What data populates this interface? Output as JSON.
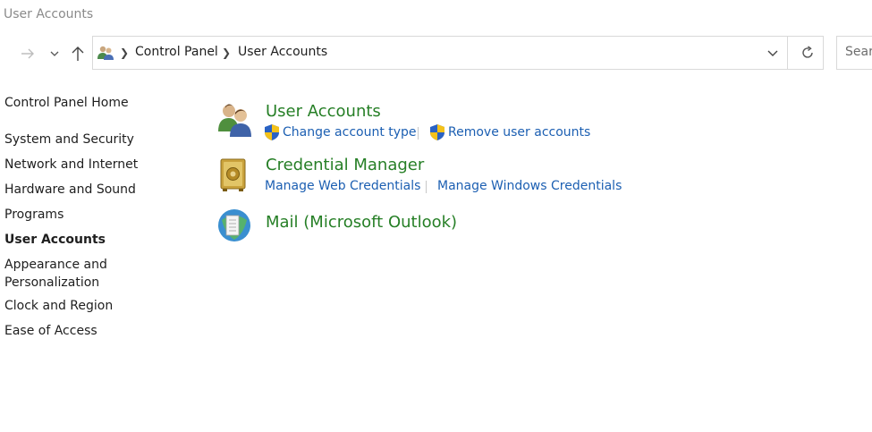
{
  "window": {
    "title": "User Accounts"
  },
  "navigation": {
    "forward_icon": "arrow-right-icon",
    "recent_icon": "chevron-down-icon",
    "up_icon": "arrow-up-icon"
  },
  "address_bar": {
    "location_icon": "user-accounts-icon",
    "breadcrumbs": [
      "Control Panel",
      "User Accounts"
    ],
    "dropdown_icon": "chevron-down-icon",
    "refresh_icon": "refresh-icon"
  },
  "search": {
    "placeholder": "Sear"
  },
  "sidebar": {
    "home": "Control Panel Home",
    "items": [
      {
        "label": "System and Security"
      },
      {
        "label": "Network and Internet"
      },
      {
        "label": "Hardware and Sound"
      },
      {
        "label": "Programs"
      },
      {
        "label": "User Accounts",
        "active": true
      },
      {
        "label": "Appearance and Personalization"
      },
      {
        "label": "Clock and Region"
      },
      {
        "label": "Ease of Access"
      }
    ]
  },
  "categories": [
    {
      "title": "User Accounts",
      "icon": "user-accounts-icon",
      "links": [
        {
          "label": "Change account type",
          "icon": "uac-shield-icon"
        },
        {
          "label": "Remove user accounts",
          "icon": "uac-shield-icon"
        }
      ]
    },
    {
      "title": "Credential Manager",
      "icon": "credential-vault-icon",
      "links": [
        {
          "label": "Manage Web Credentials"
        },
        {
          "label": "Manage Windows Credentials"
        }
      ]
    },
    {
      "title": "Mail (Microsoft Outlook)",
      "icon": "mail-icon",
      "links": []
    }
  ],
  "colors": {
    "category_title": "#267f26",
    "link": "#1c5fb2",
    "window_title": "#8a8a8a"
  }
}
